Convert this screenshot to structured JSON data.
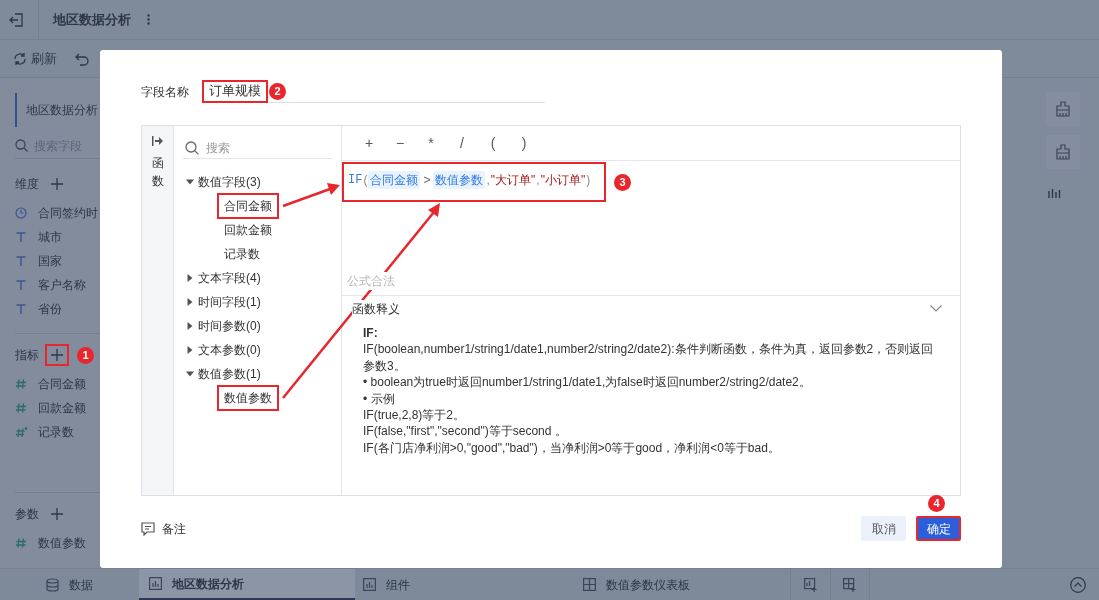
{
  "header": {
    "title": "地区数据分析"
  },
  "toolbar": [
    {
      "label": "刷新",
      "kind": "refresh"
    },
    {
      "kind": "undo"
    }
  ],
  "sidebar": {
    "tab": "地区数据分析",
    "search_placeholder": "搜索字段",
    "sections": [
      {
        "title": "维度",
        "add_highlighted": false,
        "fields": [
          {
            "name": "合同签约时",
            "kind": "time"
          },
          {
            "name": "城市",
            "kind": "text"
          },
          {
            "name": "国家",
            "kind": "text"
          },
          {
            "name": "客户名称",
            "kind": "text"
          },
          {
            "name": "省份",
            "kind": "text"
          }
        ]
      },
      {
        "title": "指标",
        "add_highlighted": true,
        "badge": "1",
        "fields": [
          {
            "name": "合同金额",
            "kind": "number"
          },
          {
            "name": "回款金额",
            "kind": "number"
          },
          {
            "name": "记录数",
            "kind": "count"
          }
        ]
      },
      {
        "title": "参数",
        "add_highlighted": false,
        "fields": [
          {
            "name": "数值参数",
            "kind": "number"
          }
        ]
      }
    ]
  },
  "bottom_tabs": [
    {
      "label": "数据",
      "kind": "data",
      "selected": false
    },
    {
      "label": "地区数据分析",
      "kind": "chart",
      "selected": true
    },
    {
      "label": "组件",
      "kind": "chart",
      "selected": false
    },
    {
      "label": "数值参数仪表板",
      "kind": "dashboard",
      "selected": false
    }
  ],
  "dialog": {
    "name_label": "字段名称",
    "name_value": "订单规模",
    "name_highlighted": true,
    "name_badge": "2",
    "function_tab": "函数",
    "tree_search_placeholder": "搜索",
    "tree": [
      {
        "label": "数值字段(3)",
        "expanded": true,
        "children": [
          {
            "label": "合同金额",
            "highlighted": true
          },
          {
            "label": "回款金额",
            "highlighted": false
          },
          {
            "label": "记录数",
            "highlighted": false
          }
        ]
      },
      {
        "label": "文本字段(4)",
        "expanded": false
      },
      {
        "label": "时间字段(1)",
        "expanded": false
      },
      {
        "label": "时间参数(0)",
        "expanded": false
      },
      {
        "label": "文本参数(0)",
        "expanded": false
      },
      {
        "label": "数值参数(1)",
        "expanded": true,
        "children": [
          {
            "label": "数值参数",
            "highlighted": true
          }
        ]
      }
    ],
    "operators": [
      "+",
      "−",
      "*",
      "/",
      "(",
      ")"
    ],
    "formula": {
      "highlighted": true,
      "badge": "3",
      "tokens": [
        {
          "kind": "func",
          "text": "IF"
        },
        {
          "kind": "punct",
          "text": "("
        },
        {
          "kind": "field",
          "text": "合同金额"
        },
        {
          "kind": "op",
          "text": ">"
        },
        {
          "kind": "field",
          "text": "数值参数"
        },
        {
          "kind": "punct",
          "text": ","
        },
        {
          "kind": "string",
          "text": "\"大订单\""
        },
        {
          "kind": "punct",
          "text": ","
        },
        {
          "kind": "string",
          "text": "\"小订单\""
        },
        {
          "kind": "punct",
          "text": ")"
        }
      ]
    },
    "status": "公式合法",
    "doc_title": "函数释义",
    "doc_expanded": true,
    "doc": [
      {
        "kind": "heading",
        "text": "IF:"
      },
      {
        "kind": "text",
        "text": "IF(boolean,number1/string1/date1,number2/string2/date2):条件判断函数，条件为真，返回参数2，否则返回参数3。"
      },
      {
        "kind": "text",
        "text": "• boolean为true时返回number1/string1/date1,为false时返回number2/string2/date2。"
      },
      {
        "kind": "text",
        "text": "• 示例"
      },
      {
        "kind": "text",
        "text": "IF(true,2,8)等于2。"
      },
      {
        "kind": "text",
        "text": "IF(false,\"first\",\"second\")等于second 。"
      },
      {
        "kind": "text",
        "text": "IF(各门店净利润>0,\"good\",\"bad\")，当净利润>0等于good，净利润<0等于bad。"
      }
    ],
    "note": "备注",
    "buttons": [
      {
        "label": "取消",
        "kind": "secondary",
        "highlighted": false
      },
      {
        "label": "确定",
        "kind": "primary",
        "highlighted": true,
        "badge": "4"
      }
    ]
  }
}
